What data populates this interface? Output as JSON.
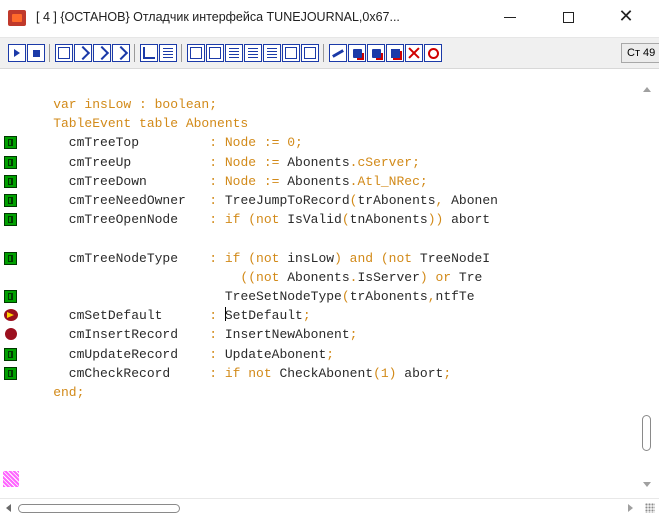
{
  "window": {
    "title": "[ 4 ]  {ОСТАНОВ} Отладчик интерфейса TUNEJOURNAL,0x67...",
    "minimize_glyph": "—",
    "maximize_glyph": "☐",
    "close_glyph": "✕"
  },
  "toolbar": {
    "status_text": "Ст 49",
    "buttons": [
      {
        "icon": "play-icon"
      },
      {
        "icon": "stop-icon"
      },
      {
        "icon": "hand-icon"
      },
      {
        "icon": "step-over-icon"
      },
      {
        "icon": "step-into-icon"
      },
      {
        "icon": "step-out-icon"
      },
      {
        "icon": "tree-icon"
      },
      {
        "icon": "grid-icon"
      },
      {
        "icon": "watch-icon"
      },
      {
        "icon": "glasses-icon"
      },
      {
        "icon": "table-icon"
      },
      {
        "icon": "table-edit-icon"
      },
      {
        "icon": "table-record-icon"
      },
      {
        "icon": "form-icon"
      },
      {
        "icon": "database-icon"
      },
      {
        "icon": "pencil-icon"
      },
      {
        "icon": "record-icon"
      },
      {
        "icon": "record-save-icon"
      },
      {
        "icon": "record-error-icon"
      },
      {
        "icon": "cancel-icon"
      },
      {
        "icon": "no-entry-icon"
      }
    ]
  },
  "editor": {
    "colors": {
      "keyword": "#d28a19",
      "identifier": "#8b4513",
      "plain": "#2a2a2a"
    },
    "lines": [
      {
        "marker": "none",
        "segments": [
          {
            "t": "    var insLow : boolean;",
            "c": "kw"
          }
        ]
      },
      {
        "marker": "none",
        "segments": [
          {
            "t": "    TableEvent table Abonents",
            "c": "kw"
          }
        ]
      },
      {
        "marker": "procedure",
        "segments": [
          {
            "t": "      cmTreeTop         ",
            "c": "pln"
          },
          {
            "t": ": Node := 0;",
            "c": "kw"
          }
        ]
      },
      {
        "marker": "procedure",
        "segments": [
          {
            "t": "      cmTreeUp          ",
            "c": "pln"
          },
          {
            "t": ": Node := ",
            "c": "kw"
          },
          {
            "t": "Abonents",
            "c": "pln"
          },
          {
            "t": ".cServer;",
            "c": "kw"
          }
        ]
      },
      {
        "marker": "procedure",
        "segments": [
          {
            "t": "      cmTreeDown        ",
            "c": "pln"
          },
          {
            "t": ": Node := ",
            "c": "kw"
          },
          {
            "t": "Abonents",
            "c": "pln"
          },
          {
            "t": ".Atl_NRec;",
            "c": "kw"
          }
        ]
      },
      {
        "marker": "procedure",
        "segments": [
          {
            "t": "      cmTreeNeedOwner   ",
            "c": "pln"
          },
          {
            "t": ": ",
            "c": "kw"
          },
          {
            "t": "TreeJumpToRecord",
            "c": "pln"
          },
          {
            "t": "(",
            "c": "kw"
          },
          {
            "t": "trAbonents",
            "c": "pln"
          },
          {
            "t": ", ",
            "c": "kw"
          },
          {
            "t": "Abonen",
            "c": "pln"
          }
        ]
      },
      {
        "marker": "procedure",
        "segments": [
          {
            "t": "      cmTreeOpenNode    ",
            "c": "pln"
          },
          {
            "t": ": if (not ",
            "c": "kw"
          },
          {
            "t": "IsValid",
            "c": "pln"
          },
          {
            "t": "(",
            "c": "kw"
          },
          {
            "t": "tnAbonents",
            "c": "pln"
          },
          {
            "t": ")) ",
            "c": "kw"
          },
          {
            "t": "abort",
            "c": "pln"
          }
        ]
      },
      {
        "marker": "none",
        "segments": [
          {
            "t": "",
            "c": "pln"
          }
        ]
      },
      {
        "marker": "procedure",
        "segments": [
          {
            "t": "      cmTreeNodeType    ",
            "c": "pln"
          },
          {
            "t": ": if (not ",
            "c": "kw"
          },
          {
            "t": "insLow",
            "c": "pln"
          },
          {
            "t": ") and (not ",
            "c": "kw"
          },
          {
            "t": "TreeNodeI",
            "c": "pln"
          }
        ]
      },
      {
        "marker": "none",
        "segments": [
          {
            "t": "                            ((not ",
            "c": "kw"
          },
          {
            "t": "Abonents",
            "c": "pln"
          },
          {
            "t": ".",
            "c": "kw"
          },
          {
            "t": "IsServer",
            "c": "pln"
          },
          {
            "t": ") or ",
            "c": "kw"
          },
          {
            "t": "Tre",
            "c": "pln"
          }
        ]
      },
      {
        "marker": "procedure",
        "segments": [
          {
            "t": "                          ",
            "c": "pln"
          },
          {
            "t": "TreeSetNodeType",
            "c": "pln"
          },
          {
            "t": "(",
            "c": "kw"
          },
          {
            "t": "trAbonents",
            "c": "pln"
          },
          {
            "t": ",",
            "c": "kw"
          },
          {
            "t": "ntfTe",
            "c": "pln"
          }
        ]
      },
      {
        "marker": "current",
        "segments": [
          {
            "t": "      cmSetDefault      ",
            "c": "pln"
          },
          {
            "t": ": ",
            "c": "kw"
          },
          {
            "t": "CARET",
            "c": "caret"
          },
          {
            "t": "SetDefault",
            "c": "pln"
          },
          {
            "t": ";",
            "c": "kw"
          }
        ]
      },
      {
        "marker": "breakpoint",
        "segments": [
          {
            "t": "      cmInsertRecord    ",
            "c": "pln"
          },
          {
            "t": ": ",
            "c": "kw"
          },
          {
            "t": "InsertNewAbonent",
            "c": "pln"
          },
          {
            "t": ";",
            "c": "kw"
          }
        ]
      },
      {
        "marker": "procedure",
        "segments": [
          {
            "t": "      cmUpdateRecord    ",
            "c": "pln"
          },
          {
            "t": ": ",
            "c": "kw"
          },
          {
            "t": "UpdateAbonent",
            "c": "pln"
          },
          {
            "t": ";",
            "c": "kw"
          }
        ]
      },
      {
        "marker": "procedure",
        "segments": [
          {
            "t": "      cmCheckRecord     ",
            "c": "pln"
          },
          {
            "t": ": if not ",
            "c": "kw"
          },
          {
            "t": "CheckAbonent",
            "c": "pln"
          },
          {
            "t": "(1) ",
            "c": "kw"
          },
          {
            "t": "abort",
            "c": "pln"
          },
          {
            "t": ";",
            "c": "kw"
          }
        ]
      },
      {
        "marker": "none",
        "segments": [
          {
            "t": "    end;",
            "c": "kw"
          }
        ]
      }
    ]
  }
}
